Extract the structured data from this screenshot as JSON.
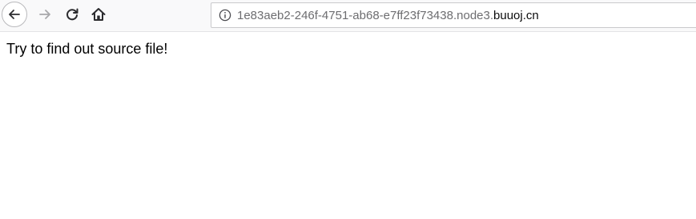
{
  "browser": {
    "icons": {
      "back": "arrow-left-icon",
      "forward": "arrow-right-icon",
      "reload": "reload-icon",
      "home": "home-icon",
      "site_info": "info-icon"
    },
    "url": {
      "prefix": "1e83aeb2-246f-4751-ab68-e7ff23f73438.node3.",
      "domain": "buuoj.cn"
    }
  },
  "page": {
    "text": "Try to find out source file!"
  }
}
